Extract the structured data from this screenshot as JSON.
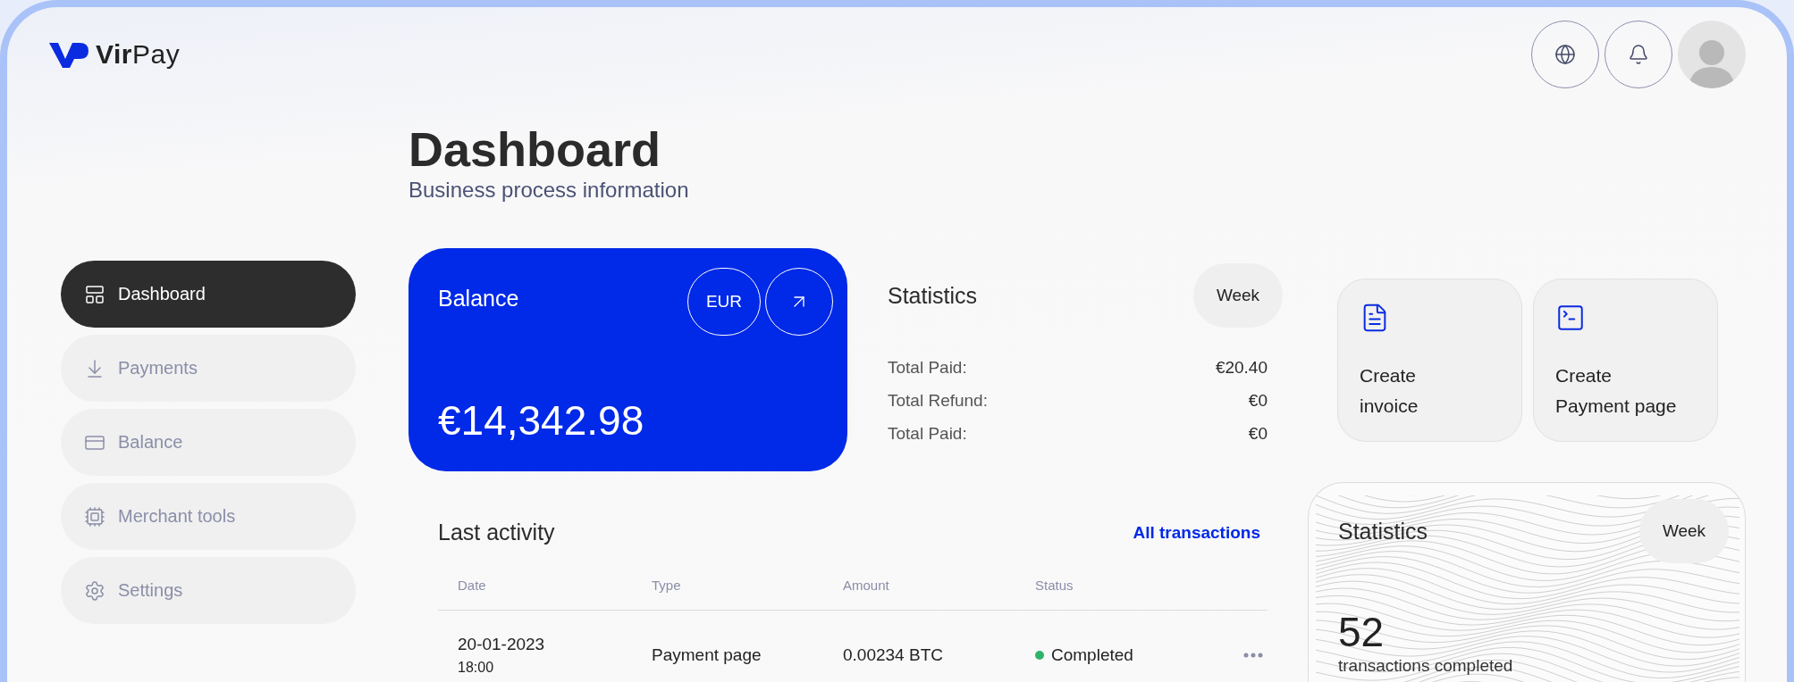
{
  "brand": {
    "name": "**Vir**Pay"
  },
  "header": {
    "title": "Dashboard",
    "subtitle": "Business process information"
  },
  "sidebar": {
    "items": [
      {
        "label": "Dashboard",
        "kind": "dashboard",
        "selected": true
      },
      {
        "label": "Payments",
        "kind": "payments",
        "selected": false
      },
      {
        "label": "Balance",
        "kind": "balance",
        "selected": false
      },
      {
        "label": "Merchant tools",
        "kind": "tools",
        "selected": false
      },
      {
        "label": "Settings",
        "kind": "settings",
        "selected": false
      }
    ]
  },
  "balance": {
    "title": "Balance",
    "currency": "EUR",
    "amount": "€14,342.98"
  },
  "statistics": {
    "title": "Statistics",
    "period": "Week",
    "rows": [
      {
        "label": "Total Paid:",
        "value": "€20.40"
      },
      {
        "label": "Total Refund:",
        "value": "€0"
      },
      {
        "label": "Total Paid:",
        "value": "€0"
      }
    ]
  },
  "actions": [
    {
      "kind": "invoice",
      "label": "Create\ninvoice"
    },
    {
      "kind": "payment_page",
      "label": "Create\nPayment page"
    }
  ],
  "activity": {
    "title": "Last activity",
    "link": "All transactions",
    "columns": [
      "Date",
      "Type",
      "Amount",
      "Status"
    ],
    "rows": [
      {
        "date": "20-01-2023",
        "time": "18:00",
        "type": "Payment page",
        "amount": "0.00234 BTC",
        "status": "Completed",
        "color": "#2fb36a"
      }
    ]
  },
  "summary": {
    "title": "Statistics",
    "period": "Week",
    "count": "52",
    "caption": "transactions completed"
  }
}
